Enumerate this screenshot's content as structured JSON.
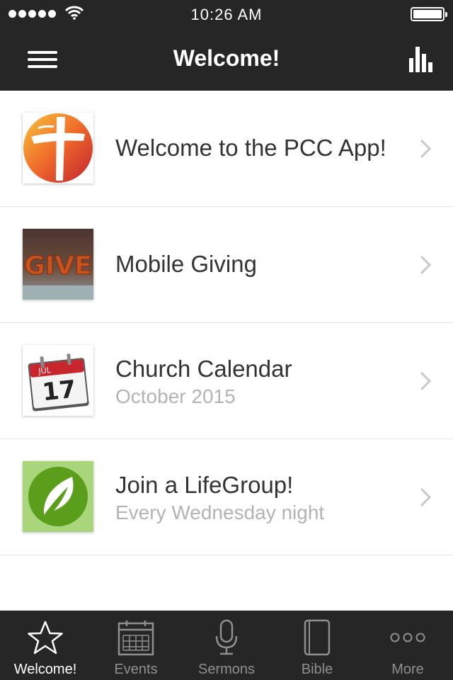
{
  "status_bar": {
    "time": "10:26 AM",
    "signal_icon": "signal-dots-icon",
    "wifi_icon": "wifi-icon",
    "battery_icon": "battery-icon",
    "battery_level": 1.0
  },
  "nav_bar": {
    "title": "Welcome!",
    "left_icon": "menu-icon",
    "right_icon": "bar-chart-icon"
  },
  "list": {
    "items": [
      {
        "title": "Welcome to the PCC App!",
        "subtitle": "",
        "thumb_icon": "cross-logo-icon"
      },
      {
        "title": "Mobile Giving",
        "subtitle": "",
        "thumb_icon": "give-letters-icon",
        "thumb_text": "GIVE"
      },
      {
        "title": "Church Calendar",
        "subtitle": "October 2015",
        "thumb_icon": "calendar-icon",
        "thumb_month": "JUL",
        "thumb_day": "17"
      },
      {
        "title": "Join a LifeGroup!",
        "subtitle": "Every Wednesday night",
        "thumb_icon": "leaf-icon"
      }
    ]
  },
  "tab_bar": {
    "tabs": [
      {
        "label": "Welcome!",
        "icon": "star-icon",
        "active": true
      },
      {
        "label": "Events",
        "icon": "calendar-grid-icon",
        "active": false
      },
      {
        "label": "Sermons",
        "icon": "microphone-icon",
        "active": false
      },
      {
        "label": "Bible",
        "icon": "book-icon",
        "active": false
      },
      {
        "label": "More",
        "icon": "more-dots-icon",
        "active": false
      }
    ]
  },
  "colors": {
    "bar_background": "#262626",
    "active_tab": "#ffffff",
    "inactive_tab": "#8f8f8f",
    "title_text": "#333333",
    "subtitle_text": "#b3b3b3"
  }
}
